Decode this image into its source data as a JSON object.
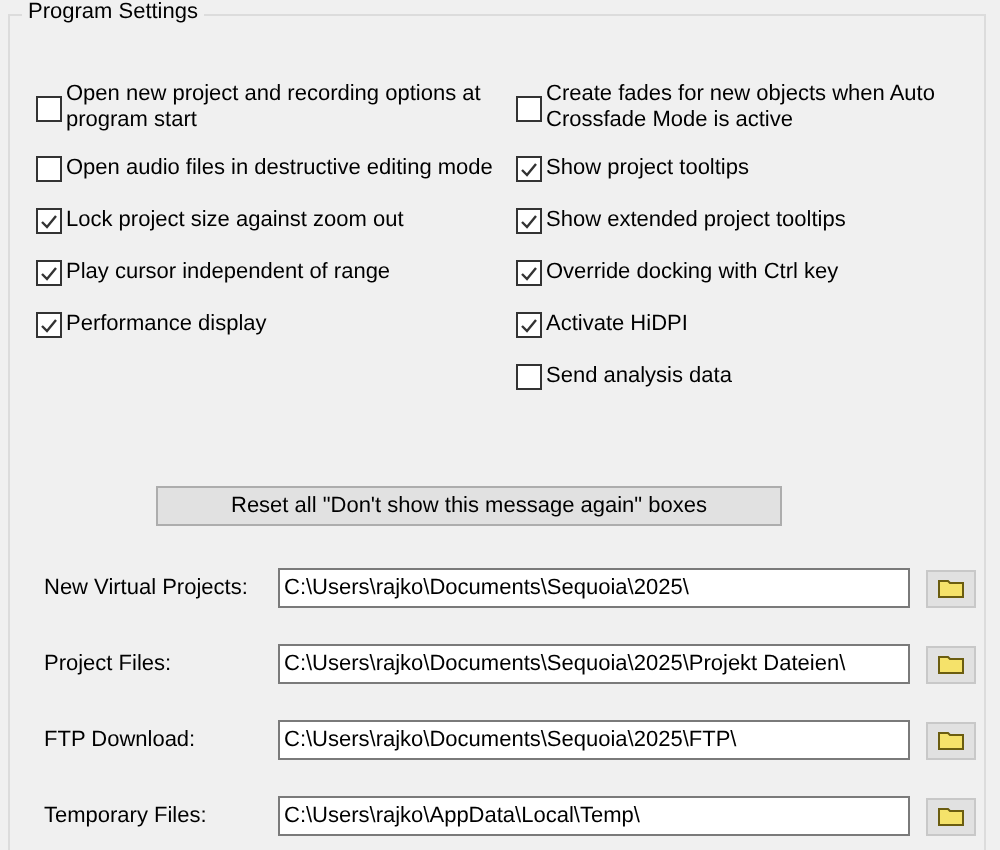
{
  "group": {
    "title": "Program Settings"
  },
  "left_options": [
    {
      "label": "Open new project and recording options at program start",
      "checked": false
    },
    {
      "label": "Open audio files in destructive editing mode",
      "checked": false
    },
    {
      "label": "Lock project size against zoom out",
      "checked": true
    },
    {
      "label": "Play cursor independent of range",
      "checked": true
    },
    {
      "label": "Performance display",
      "checked": true
    }
  ],
  "right_options": [
    {
      "label": "Create fades for new objects when Auto Crossfade Mode is active",
      "checked": false
    },
    {
      "label": "Show project tooltips",
      "checked": true
    },
    {
      "label": "Show extended project tooltips",
      "checked": true
    },
    {
      "label": "Override docking with Ctrl key",
      "checked": true
    },
    {
      "label": "Activate HiDPI",
      "checked": true
    },
    {
      "label": "Send analysis data",
      "checked": false
    }
  ],
  "reset_button": "Reset all \"Don't show this message again\" boxes",
  "paths": [
    {
      "label": "New Virtual Projects:",
      "value": "C:\\Users\\rajko\\Documents\\Sequoia\\2025\\"
    },
    {
      "label": "Project Files:",
      "value": "C:\\Users\\rajko\\Documents\\Sequoia\\2025\\Projekt Dateien\\"
    },
    {
      "label": "FTP Download:",
      "value": "C:\\Users\\rajko\\Documents\\Sequoia\\2025\\FTP\\"
    },
    {
      "label": "Temporary Files:",
      "value": "C:\\Users\\rajko\\AppData\\Local\\Temp\\"
    }
  ]
}
